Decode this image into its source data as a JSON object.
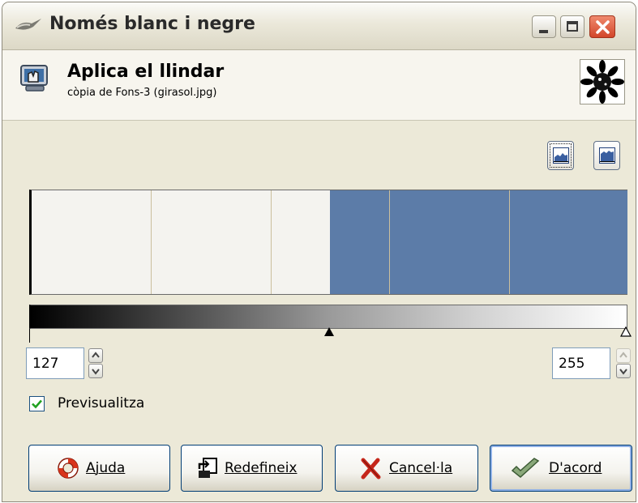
{
  "window": {
    "title": "Només blanc i negre"
  },
  "header": {
    "title": "Aplica el llindar",
    "subtitle": "còpia de Fons-3 (girasol.jpg)"
  },
  "threshold": {
    "low": "127",
    "high": "255"
  },
  "preview": {
    "label": "Previsualitza",
    "checked": true
  },
  "buttons": {
    "help": "Ajuda",
    "reset": "Redefineix",
    "cancel": "Cancel·la",
    "ok": "D'acord"
  },
  "colors": {
    "selection": "#5c7ca8",
    "dialog_bg": "#ece9d8"
  },
  "icons": {
    "app": "brush-icon",
    "header": "threshold-tool-icon",
    "preview_thumb": "sunflower-thumbnail",
    "help": "lifebuoy-icon",
    "reset": "reset-icon",
    "cancel": "x-icon",
    "ok": "check-icon"
  }
}
